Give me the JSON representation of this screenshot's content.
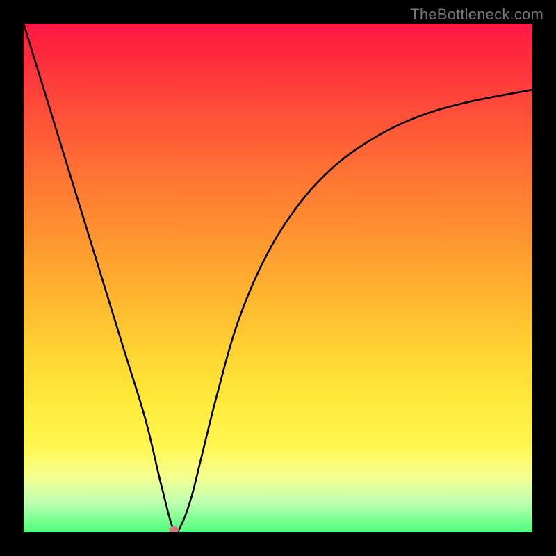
{
  "watermark": "TheBottleneck.com",
  "chart_data": {
    "type": "line",
    "title": "",
    "xlabel": "",
    "ylabel": "",
    "xlim": [
      0,
      100
    ],
    "ylim": [
      0,
      100
    ],
    "grid": false,
    "legend": false,
    "series": [
      {
        "name": "bottleneck-curve",
        "x": [
          0,
          4,
          8,
          12,
          16,
          20,
          24,
          27,
          29.5,
          31,
          33,
          35,
          38,
          42,
          47,
          53,
          60,
          68,
          77,
          87,
          100
        ],
        "y": [
          100,
          87,
          74,
          61,
          48,
          35,
          22,
          9.5,
          0.5,
          1.5,
          7,
          15,
          27,
          41,
          53,
          63,
          71,
          77,
          81.5,
          84.5,
          87
        ]
      }
    ],
    "markers": [
      {
        "name": "optimal-point",
        "x": 29.5,
        "y": 0.5,
        "color": "#cc7a7a"
      }
    ],
    "background_gradient": {
      "direction": "vertical",
      "stops": [
        {
          "pos": 0.0,
          "color": "#ff1744"
        },
        {
          "pos": 0.28,
          "color": "#ff6f34"
        },
        {
          "pos": 0.55,
          "color": "#ffb92f"
        },
        {
          "pos": 0.74,
          "color": "#ffea3b"
        },
        {
          "pos": 0.89,
          "color": "#f6ff8f"
        },
        {
          "pos": 1.0,
          "color": "#4cff7b"
        }
      ]
    }
  }
}
